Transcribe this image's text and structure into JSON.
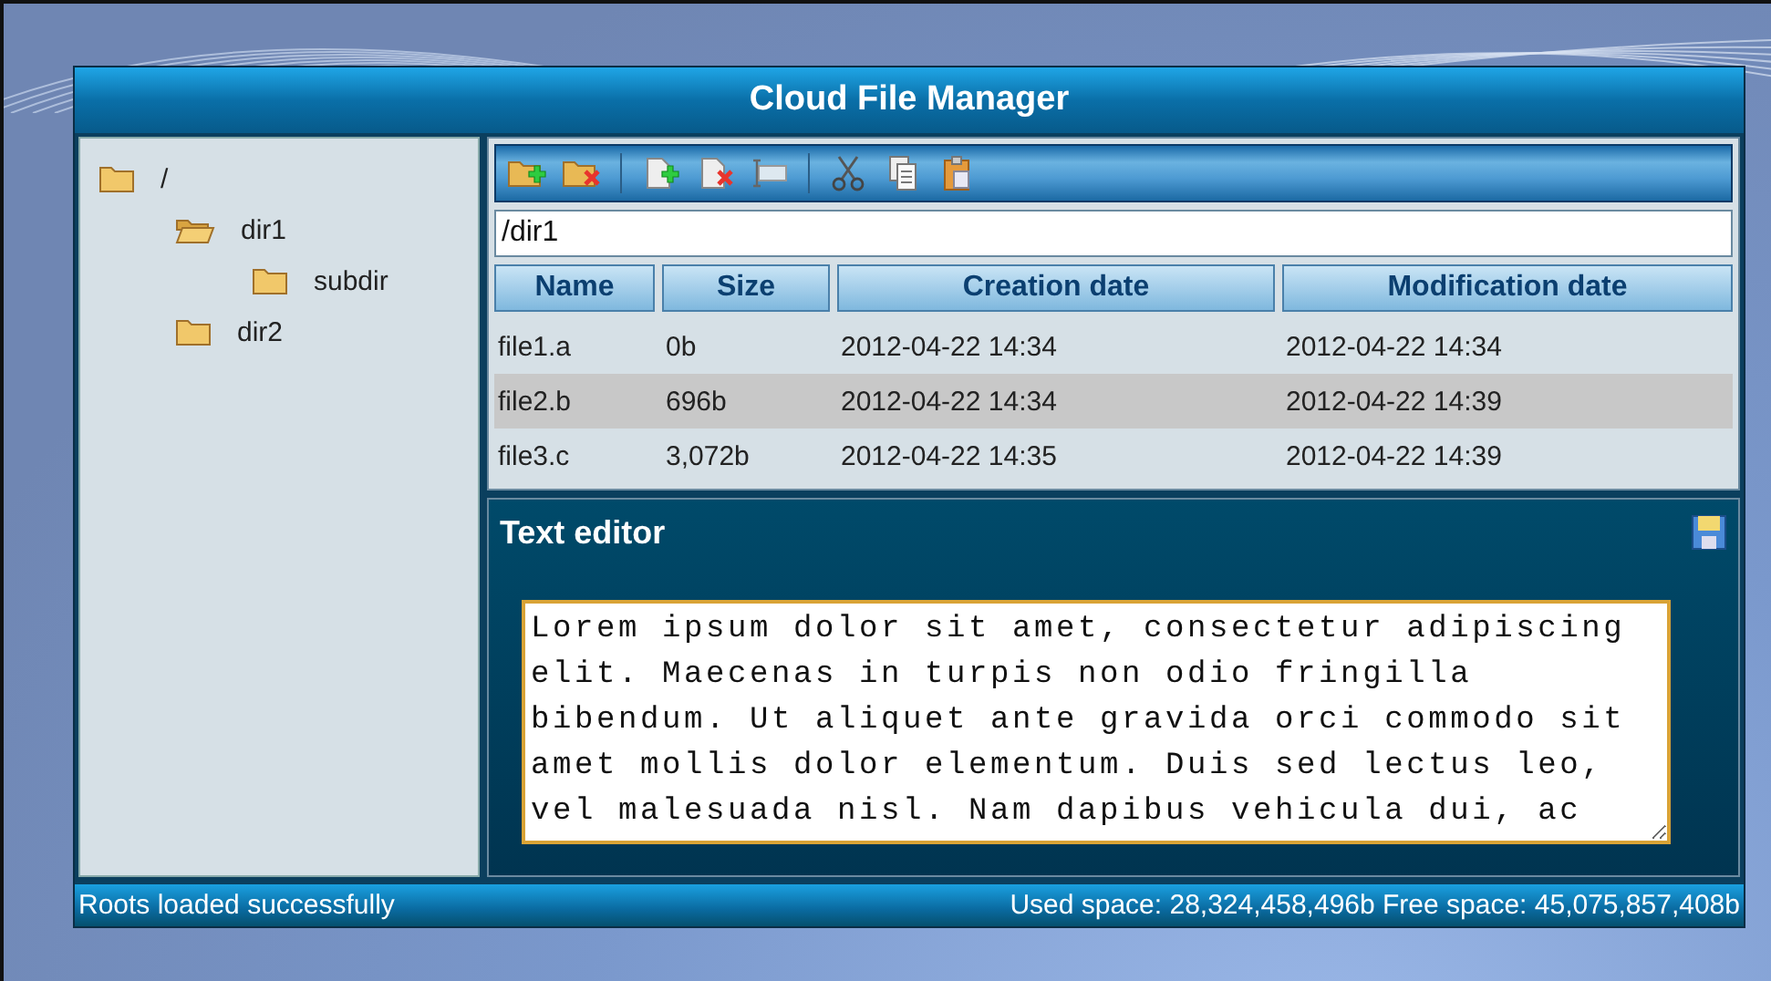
{
  "window": {
    "title": "Cloud File Manager"
  },
  "tree": [
    {
      "label": "/",
      "expanded": false,
      "children": [
        {
          "label": "dir1",
          "expanded": true,
          "children": [
            {
              "label": "subdir",
              "expanded": false
            }
          ]
        },
        {
          "label": "dir2",
          "expanded": false
        }
      ]
    }
  ],
  "toolbar": [
    {
      "kind": "new-folder"
    },
    {
      "kind": "delete-folder"
    },
    {
      "kind": "separator"
    },
    {
      "kind": "new-file"
    },
    {
      "kind": "delete-file"
    },
    {
      "kind": "rename"
    },
    {
      "kind": "separator"
    },
    {
      "kind": "cut"
    },
    {
      "kind": "copy"
    },
    {
      "kind": "paste"
    }
  ],
  "path": {
    "value": "/dir1"
  },
  "table": {
    "columns": [
      "Name",
      "Size",
      "Creation date",
      "Modification date"
    ],
    "rows": [
      {
        "cells": [
          "file1.a",
          "0b",
          "2012-04-22 14:34",
          "2012-04-22 14:34"
        ],
        "selected": false
      },
      {
        "cells": [
          "file2.b",
          "696b",
          "2012-04-22 14:34",
          "2012-04-22 14:39"
        ],
        "selected": true
      },
      {
        "cells": [
          "file3.c",
          "3,072b",
          "2012-04-22 14:35",
          "2012-04-22 14:39"
        ],
        "selected": false
      }
    ]
  },
  "editor": {
    "title": "Text editor",
    "value": "Lorem ipsum dolor sit amet, consectetur adipiscing elit. Maecenas in turpis non odio fringilla bibendum. Ut aliquet ante gravida orci commodo sit amet mollis dolor elementum. Duis sed lectus leo, vel malesuada nisl. Nam dapibus vehicula dui, ac"
  },
  "status_bar": {
    "message": "Roots loaded successfully",
    "space": "Used space: 28,324,458,496b Free space: 45,075,857,408b"
  }
}
